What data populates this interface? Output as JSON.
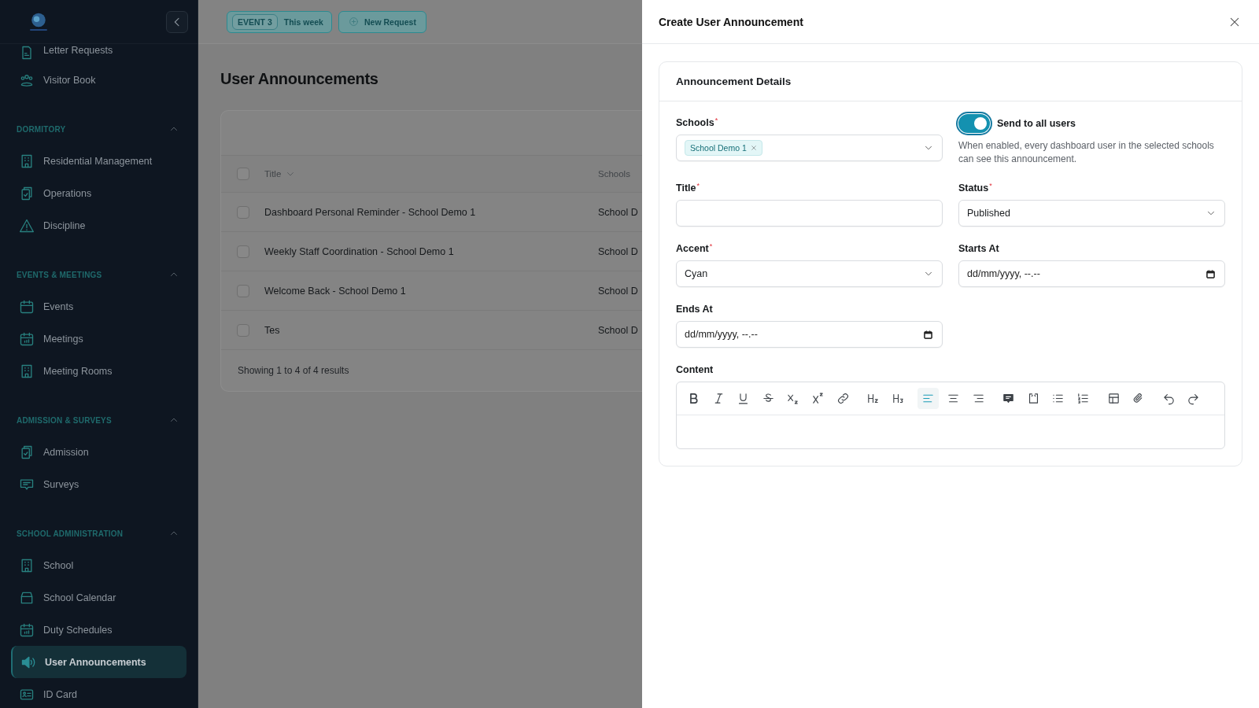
{
  "sidebar": {
    "items": [
      {
        "label": "Letter Requests",
        "kind": "document",
        "selected": false
      },
      {
        "label": "Visitor Book",
        "kind": "people",
        "selected": false
      }
    ],
    "groups": [
      {
        "label": "DORMITORY",
        "expanded": true,
        "items": [
          {
            "label": "Residential Management",
            "kind": "building",
            "selected": false
          },
          {
            "label": "Operations",
            "kind": "clipboard",
            "selected": false
          },
          {
            "label": "Discipline",
            "kind": "warning",
            "selected": false
          }
        ]
      },
      {
        "label": "EVENTS & MEETINGS",
        "expanded": true,
        "items": [
          {
            "label": "Events",
            "kind": "calendar",
            "selected": false
          },
          {
            "label": "Meetings",
            "kind": "calendar-grid",
            "selected": false
          },
          {
            "label": "Meeting Rooms",
            "kind": "building",
            "selected": false
          }
        ]
      },
      {
        "label": "ADMISSION & SURVEYS",
        "expanded": true,
        "items": [
          {
            "label": "Admission",
            "kind": "clipboard",
            "selected": false
          },
          {
            "label": "Surveys",
            "kind": "chat",
            "selected": false
          }
        ]
      },
      {
        "label": "SCHOOL ADMINISTRATION",
        "expanded": true,
        "items": [
          {
            "label": "School",
            "kind": "building",
            "selected": false
          },
          {
            "label": "School Calendar",
            "kind": "tray",
            "selected": false
          },
          {
            "label": "Duty Schedules",
            "kind": "calendar-grid",
            "selected": false
          },
          {
            "label": "User Announcements",
            "kind": "speaker",
            "selected": true
          },
          {
            "label": "ID Card",
            "kind": "id-card",
            "selected": false
          }
        ]
      }
    ]
  },
  "topbar": {
    "event_badge": "EVENT 3",
    "event_label": "This week",
    "new_request": "New Request"
  },
  "page": {
    "title": "User Announcements",
    "table": {
      "columns": [
        "Title",
        "Schools"
      ],
      "header_checked": false,
      "rows": [
        {
          "title": "Dashboard Personal Reminder - School Demo 1",
          "schools": "School D",
          "checked": false
        },
        {
          "title": "Weekly Staff Coordination - School Demo 1",
          "schools": "School D",
          "checked": false
        },
        {
          "title": "Welcome Back - School Demo 1",
          "schools": "School D",
          "checked": false
        },
        {
          "title": "Tes",
          "schools": "School D",
          "checked": false
        }
      ],
      "footer": "Showing 1 to 4 of 4 results"
    }
  },
  "drawer": {
    "title": "Create User Announcement",
    "card_title": "Announcement Details",
    "schools": {
      "label": "Schools",
      "required_mark": "*",
      "tags": [
        "School Demo 1"
      ]
    },
    "send_to_all": {
      "label": "Send to all users",
      "on": true,
      "help": "When enabled, every dashboard user in the selected schools can see this announcement."
    },
    "title_field": {
      "label": "Title",
      "required_mark": "*"
    },
    "status": {
      "label": "Status",
      "required_mark": "*",
      "value": "Published"
    },
    "accent": {
      "label": "Accent",
      "required_mark": "*",
      "value": "Cyan"
    },
    "starts_at": {
      "label": "Starts At",
      "placeholder": "dd/mm/yyyy, --.--"
    },
    "ends_at": {
      "label": "Ends At",
      "placeholder": "dd/mm/yyyy, --.--"
    },
    "content": {
      "label": "Content",
      "toolbar": [
        {
          "kind": "bold",
          "selected": false
        },
        {
          "kind": "italic",
          "selected": false
        },
        {
          "kind": "underline",
          "selected": false
        },
        {
          "kind": "strike",
          "selected": false
        },
        {
          "kind": "subscript",
          "selected": false
        },
        {
          "kind": "superscript",
          "selected": false
        },
        {
          "kind": "link",
          "selected": false
        },
        {
          "kind": "h2",
          "selected": false
        },
        {
          "kind": "h3",
          "selected": false
        },
        {
          "kind": "align-left",
          "selected": true
        },
        {
          "kind": "align-center",
          "selected": false
        },
        {
          "kind": "align-right",
          "selected": false
        },
        {
          "kind": "comment",
          "selected": false
        },
        {
          "kind": "code",
          "selected": false
        },
        {
          "kind": "bullet-list",
          "selected": false
        },
        {
          "kind": "ordered-list",
          "selected": false
        },
        {
          "kind": "table",
          "selected": false
        },
        {
          "kind": "attachment",
          "selected": false
        },
        {
          "kind": "undo",
          "selected": false
        },
        {
          "kind": "redo",
          "selected": false
        }
      ]
    }
  }
}
